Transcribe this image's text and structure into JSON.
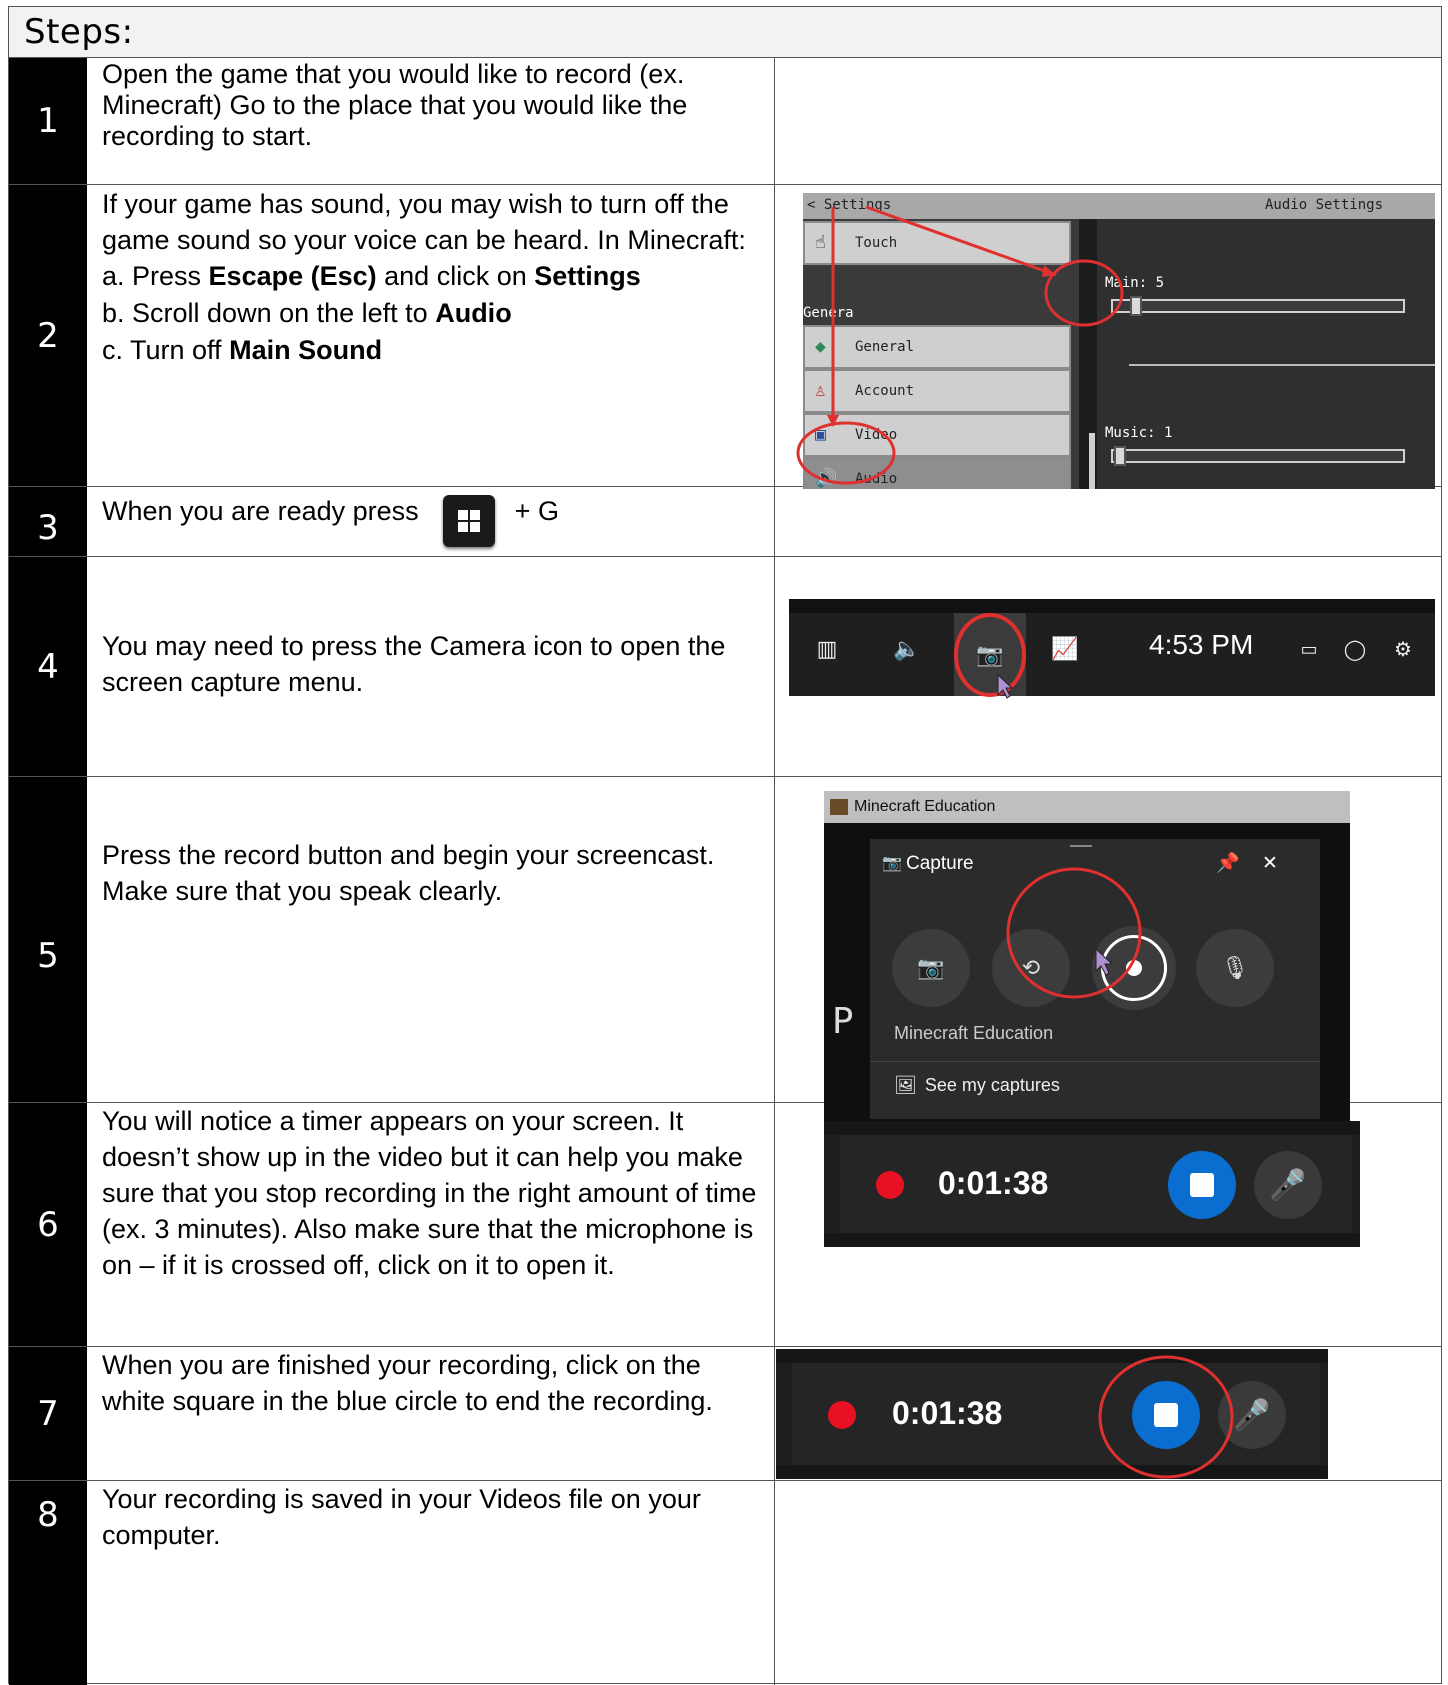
{
  "header": {
    "title": "Steps:"
  },
  "steps": [
    {
      "number": "1",
      "text": "Open the game that you would like to record (ex. Minecraft) Go to the place that you would like the recording to start."
    },
    {
      "number": "2",
      "intro": "If your game has sound, you may wish to turn off the game sound so your voice can be heard.  In Minecraft:",
      "a_pre": "a. Press ",
      "a_b1": "Escape (Esc)",
      "a_mid": " and click on ",
      "a_b2": "Settings",
      "b_pre": "b. Scroll down on the left to ",
      "b_b": "Audio",
      "c_pre": "c. Turn off ",
      "c_b": "Main Sound"
    },
    {
      "number": "3",
      "pre": "When you are ready press",
      "post": "+ G"
    },
    {
      "number": "4",
      "text": "You may need to press the Camera icon to open the screen capture menu."
    },
    {
      "number": "5",
      "text": "Press the record button and begin your screencast. Make sure that you speak clearly."
    },
    {
      "number": "6",
      "text": "You will notice a timer appears on your screen. It doesn’t show up in the video but it can help you make sure that you stop recording in the right amount of time (ex. 3 minutes).  Also make sure that the microphone is on – if it is crossed off, click on it to open it."
    },
    {
      "number": "7",
      "text": "When you are finished your recording, click on the white square in the blue circle to end the recording."
    },
    {
      "number": "8",
      "text": "Your recording is saved in your Videos file on your computer."
    }
  ],
  "minecraft": {
    "back": "< Settings",
    "panel_title": "Audio Settings",
    "category": "Genera",
    "items": [
      "Touch",
      "General",
      "Account",
      "Video",
      "Audio"
    ],
    "main_label": "Main: 5",
    "music_label": "Music: 1",
    "main_level": 0.05,
    "music_level": 0.01
  },
  "xbox_bar": {
    "time": "4:53 PM"
  },
  "capture": {
    "app_title": "Minecraft Education",
    "panel_title": "Capture",
    "game_name": "Minecraft Education",
    "see_captures": "See my captures"
  },
  "timer": {
    "elapsed": "0:01:38"
  },
  "annotation_color": "#e03030"
}
